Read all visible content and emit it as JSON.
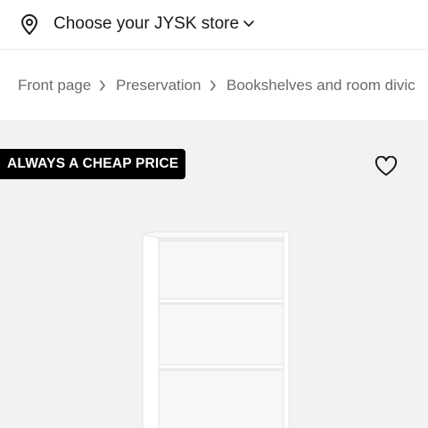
{
  "store_selector": {
    "label": "Choose your JYSK store",
    "icon": "location-pin-icon",
    "chevron_icon": "chevron-down-icon"
  },
  "breadcrumb": {
    "items": [
      "Front page",
      "Preservation",
      "Bookshelves and room divic"
    ],
    "separator_icon": "chevron-right-icon"
  },
  "product": {
    "badge": "ALWAYS A CHEAP PRICE",
    "favorite_icon": "heart-outline-icon",
    "image": "white-bookshelf-image",
    "colors": {
      "badge_bg": "#000000",
      "badge_text": "#ffffff",
      "hero_bg": "#f2f2f2"
    }
  }
}
